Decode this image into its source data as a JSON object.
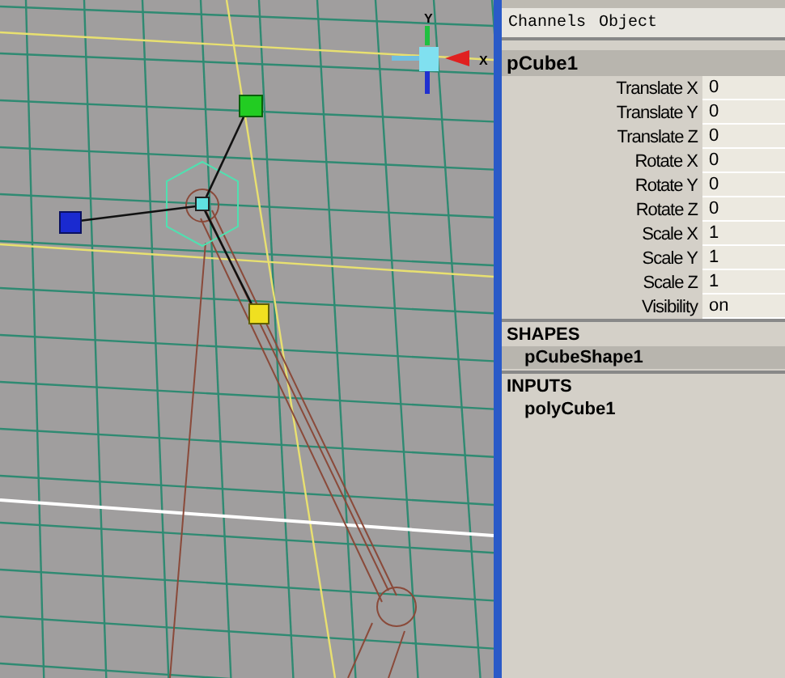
{
  "viewport": {
    "axis_labels": [
      {
        "kind": "y",
        "text": "Y"
      },
      {
        "kind": "x",
        "text": "X"
      }
    ]
  },
  "channel_box": {
    "menu": [
      "Channels",
      "Object"
    ],
    "node": "pCube1",
    "channels": [
      {
        "name": "Translate X",
        "value": "0"
      },
      {
        "name": "Translate Y",
        "value": "0"
      },
      {
        "name": "Translate Z",
        "value": "0"
      },
      {
        "name": "Rotate X",
        "value": "0"
      },
      {
        "name": "Rotate Y",
        "value": "0"
      },
      {
        "name": "Rotate Z",
        "value": "0"
      },
      {
        "name": "Scale X",
        "value": "1"
      },
      {
        "name": "Scale Y",
        "value": "1"
      },
      {
        "name": "Scale Z",
        "value": "1"
      },
      {
        "name": "Visibility",
        "value": "on"
      }
    ],
    "sections": [
      {
        "title": "SHAPES",
        "items": [
          {
            "label": "pCubeShape1",
            "selected": true
          }
        ]
      },
      {
        "title": "INPUTS",
        "items": [
          {
            "label": "polyCube1",
            "selected": false
          }
        ]
      }
    ]
  }
}
